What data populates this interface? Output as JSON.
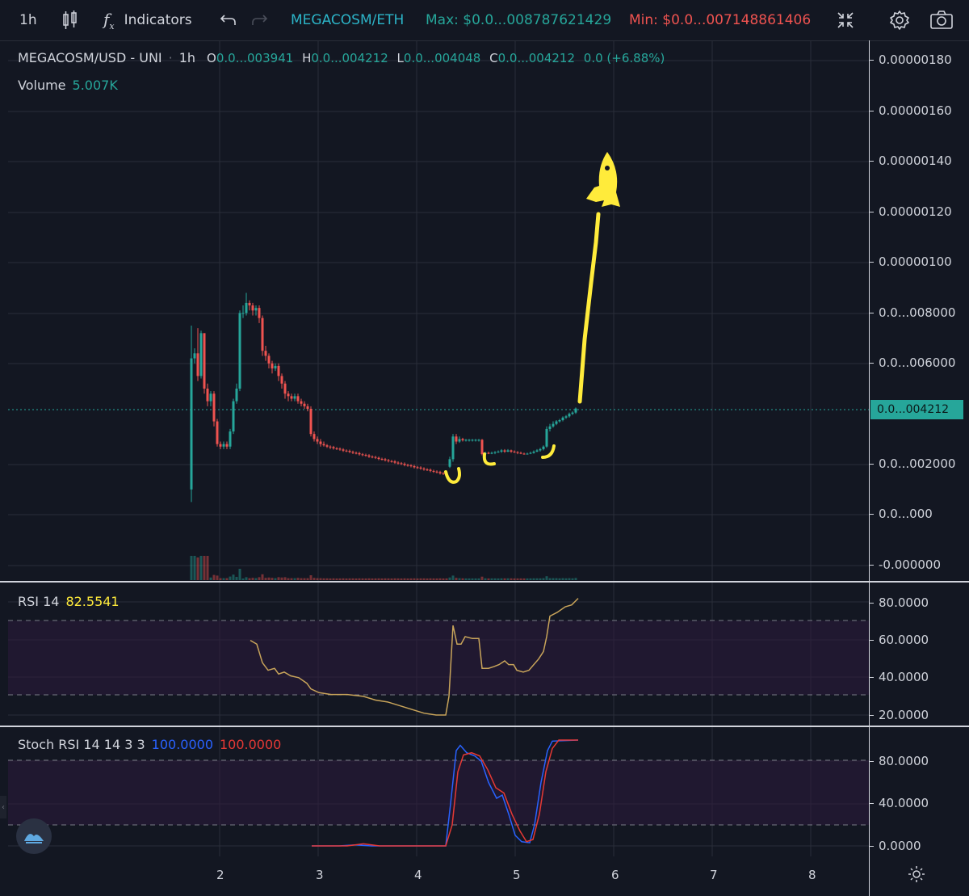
{
  "toolbar": {
    "interval": "1h",
    "indicators_label": "Indicators",
    "pair": "MEGACOSM/ETH",
    "max_label": "Max: $0.0...008787621429",
    "min_label": "Min: $0.0...007148861406"
  },
  "legend": {
    "symbol": "MEGACOSM/USD - UNI",
    "interval": "1h",
    "o_label": "O",
    "o_value": "0.0...003941",
    "h_label": "H",
    "h_value": "0.0...004212",
    "l_label": "L",
    "l_value": "0.0...004048",
    "c_label": "C",
    "c_value": "0.0...004212",
    "change": "0.0 (+6.88%)",
    "volume_label": "Volume",
    "volume_value": "5.007K"
  },
  "price_axis": {
    "ticks": [
      "0.00000180",
      "0.00000160",
      "0.00000140",
      "0.00000120",
      "0.00000100",
      "0.0...008000",
      "0.0...006000",
      "0.0...004212",
      "0.0...002000",
      "0.0...000",
      "-0.000000"
    ],
    "last_price": "0.0...004212"
  },
  "rsi": {
    "label": "RSI 14",
    "value": "82.5541",
    "ticks": [
      "80.0000",
      "60.0000",
      "40.0000",
      "20.0000"
    ]
  },
  "stoch": {
    "label": "Stoch RSI 14 14 3 3",
    "k_value": "100.0000",
    "d_value": "100.0000",
    "ticks": [
      "80.0000",
      "40.0000",
      "0.0000"
    ]
  },
  "time_axis": {
    "ticks": [
      "2",
      "3",
      "4",
      "5",
      "6",
      "7",
      "8"
    ]
  },
  "colors": {
    "background": "#131722",
    "up": "#26a69a",
    "down": "#ef5350",
    "pair": "#2cb4c8",
    "rsi_line": "#c8a45a",
    "stoch_k": "#2962ff",
    "stoch_d": "#e53935",
    "annotation": "#ffeb3b"
  },
  "icons": [
    "candles-icon",
    "fx-icon",
    "undo-icon",
    "redo-icon",
    "fullscreen-icon",
    "settings-icon",
    "camera-icon",
    "gear-icon",
    "logo-icon"
  ]
}
